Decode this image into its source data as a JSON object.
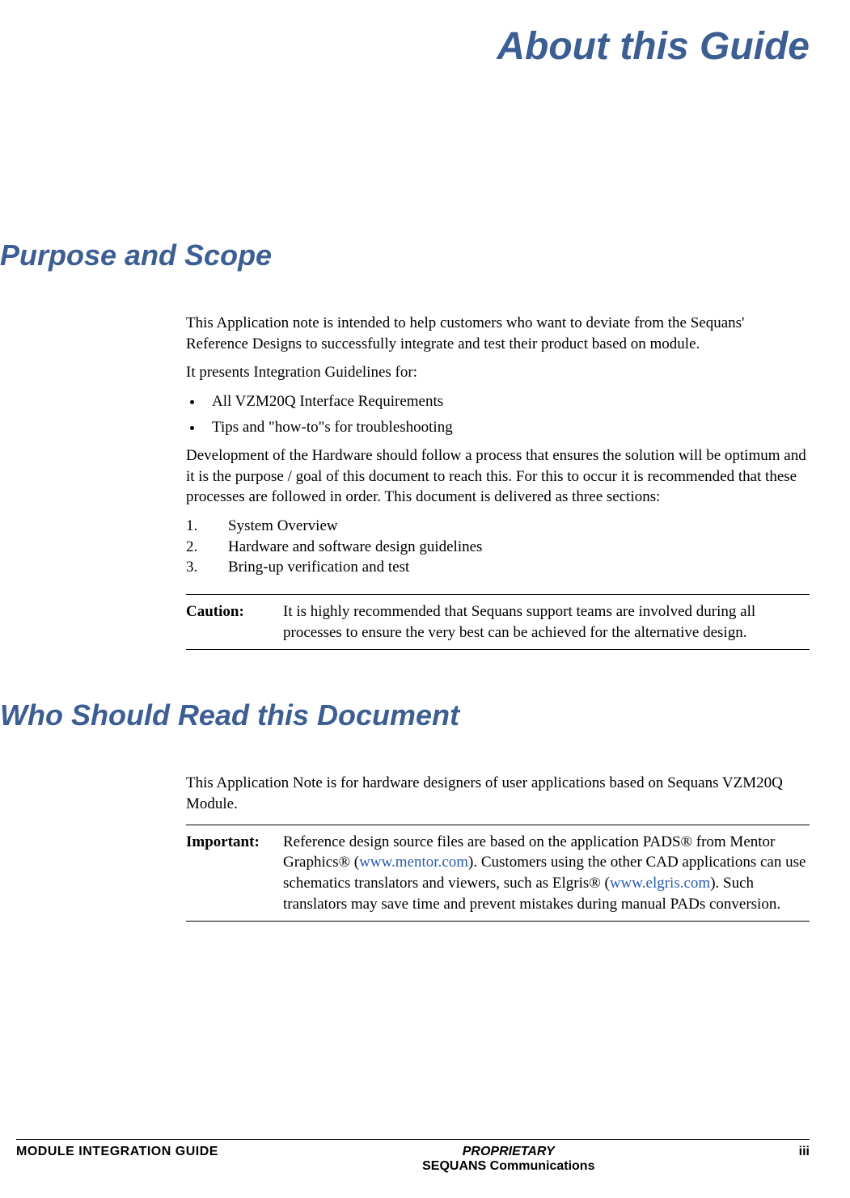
{
  "title": "About this Guide",
  "section1": {
    "heading": "Purpose and Scope",
    "p1": "This Application note is intended to help customers who want to deviate from the Sequans' Reference Designs to successfully integrate and test their product based on module.",
    "p2": "It presents Integration Guidelines for:",
    "bullets": [
      "All VZM20Q Interface Requirements",
      "Tips and \"how-to\"s for troubleshooting"
    ],
    "p3": "Development of the Hardware should follow a process that ensures the solution will be optimum and it is the purpose / goal of this document to reach this. For this to occur it is recommended that these processes are followed in order. This document is delivered as three sections:",
    "numbered": [
      "System Overview",
      "Hardware and software design guidelines",
      "Bring-up verification and test"
    ],
    "caution_label": "Caution:",
    "caution_text": "It is highly recommended that Sequans support teams are involved during all processes to ensure the very best can be achieved for the alternative design."
  },
  "section2": {
    "heading": "Who Should Read this Document",
    "p1": "This Application Note is for hardware designers of user applications based on Sequans VZM20Q Module.",
    "important_label": "Important:",
    "important_pre": "Reference design source files are based on the application PADS® from Mentor Graphics® (",
    "link1": "www.mentor.com",
    "important_mid": "). Customers using the other CAD applications can use schematics translators and viewers, such as Elgris® (",
    "link2": "www.elgris.com",
    "important_post": "). Such translators may save time and prevent mistakes during manual PADs conversion."
  },
  "footer": {
    "left": "MODULE INTEGRATION GUIDE",
    "center_top": "PROPRIETARY",
    "center_bottom": "SEQUANS Communications",
    "right": "iii"
  }
}
